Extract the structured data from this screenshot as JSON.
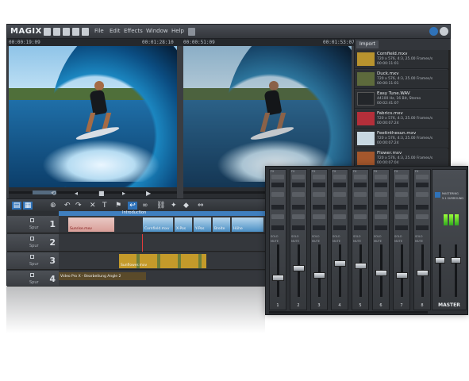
{
  "app": {
    "logo": "MAGIX",
    "menu": [
      "File",
      "Edit",
      "Effects",
      "Window",
      "Help"
    ],
    "timecodes": {
      "left_start": "00:00:19:09",
      "left_end": "00:01:28:10",
      "right_start": "00:00:51:09",
      "right_end": "00:01:53:07"
    }
  },
  "tracks": [
    {
      "number": "1",
      "label": "Spur"
    },
    {
      "number": "2",
      "label": "Spur"
    },
    {
      "number": "3",
      "label": "Spur"
    },
    {
      "number": "4",
      "label": "Spur"
    }
  ],
  "ruler": {
    "label": "Introduction"
  },
  "clips": {
    "track1_a": "Sunrise.mxv",
    "track1_b": "Cornfield.mxv",
    "track1_c": "X-Pos",
    "track1_d": "Y-Pos",
    "track1_e": "Breite",
    "track1_f": "Höhe",
    "track3_a": "Sunflower.mxv",
    "track4_a": "Video Pro X - Bearbeitung Angle 2"
  },
  "media_pool": {
    "tab": "Import",
    "items": [
      {
        "name": "Cornfield.mxv",
        "line1": "720 x 576, 4:3, 25.00 Frames/s",
        "line2": "00:00:11:01"
      },
      {
        "name": "Duck.mxv",
        "line1": "720 x 576, 4:3, 25.00 Frames/s",
        "line2": "00:00:11:01"
      },
      {
        "name": "Easy Tune.WAV",
        "line1": "44100 Hz, 16 Bit, Stereo",
        "line2": "00:02:41:07"
      },
      {
        "name": "Fabrics.mxv",
        "line1": "720 x 576, 4:3, 25.00 Frames/s",
        "line2": "00:00:07:24"
      },
      {
        "name": "Feetinthesun.mxv",
        "line1": "720 x 576, 4:3, 25.00 Frames/s",
        "line2": "00:00:07:24"
      },
      {
        "name": "Flower.mxv",
        "line1": "720 x 576, 4:3, 25.00 Frames/s",
        "line2": "00:00:07:04"
      }
    ]
  },
  "mixer": {
    "channels": [
      "1",
      "2",
      "3",
      "4",
      "5",
      "6",
      "7",
      "8"
    ],
    "fx_label": "FX",
    "solo_label": "SOLO",
    "mute_label": "MUTE",
    "master_title": "MASTERING",
    "master_sub": "5.1 SURROUND",
    "master_label": "MASTER",
    "fader_levels": [
      0.35,
      0.55,
      0.4,
      0.65,
      0.6,
      0.45,
      0.4,
      0.45
    ]
  },
  "colors": {
    "accent": "#2f72b8",
    "window": "#3a3d42",
    "meter": "#7fe22e"
  }
}
